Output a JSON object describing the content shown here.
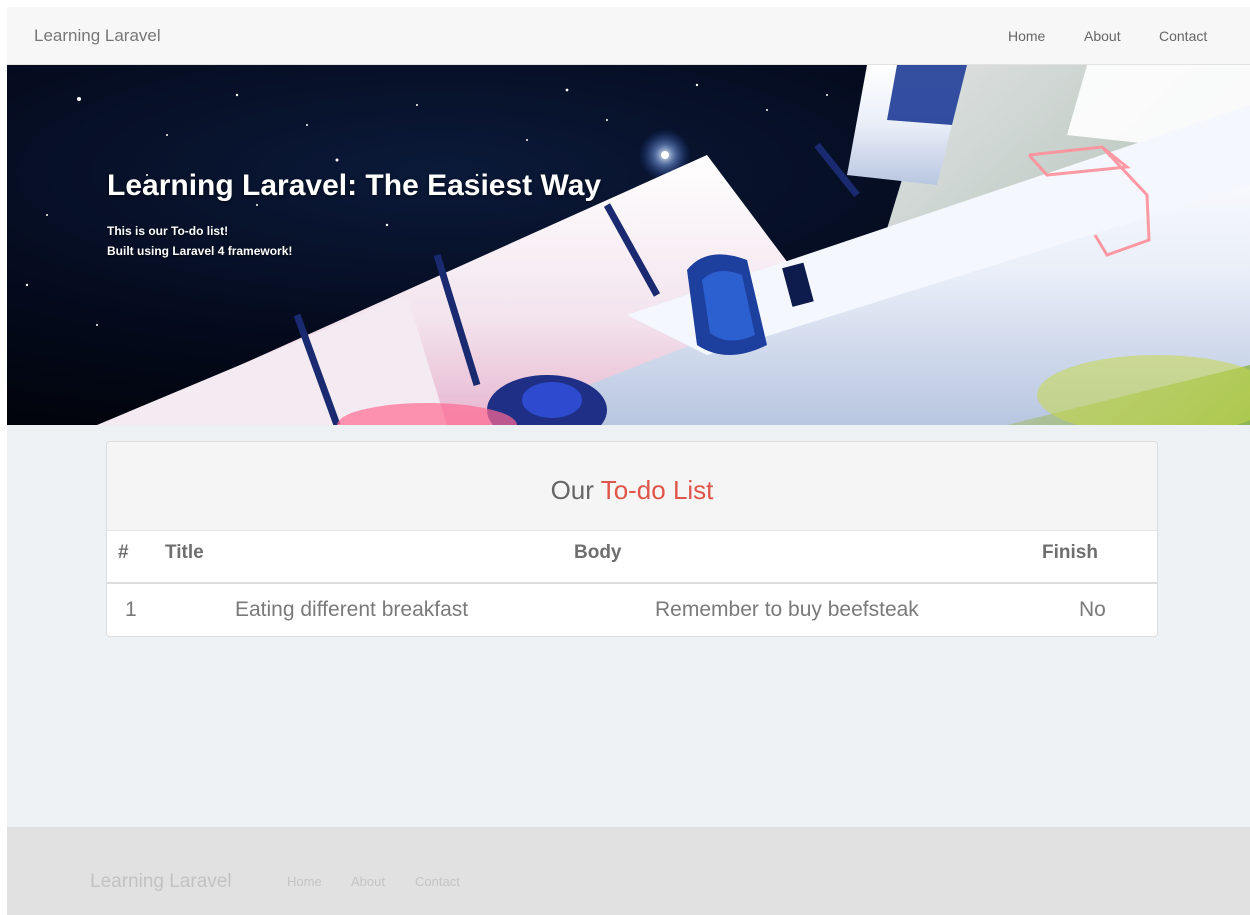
{
  "navbar": {
    "brand": "Learning Laravel",
    "links": [
      "Home",
      "About",
      "Contact"
    ]
  },
  "hero": {
    "title": "Learning Laravel: The Easiest Way",
    "lines": [
      "This is our To-do list!",
      "Built using Laravel 4 framework!"
    ]
  },
  "panel": {
    "title_prefix": "Our ",
    "title_accent": "To-do List",
    "columns": [
      "#",
      "Title",
      "Body",
      "Finish"
    ],
    "rows": [
      [
        "1",
        "Eating different breakfast",
        "Remember to buy beefsteak",
        "No"
      ]
    ]
  },
  "footer": {
    "brand": "Learning Laravel",
    "links": [
      "Home",
      "About",
      "Contact"
    ]
  },
  "colors": {
    "accent": "#e0554a",
    "navbar_bg": "#f7f7f7",
    "page_bg": "#eef1f3",
    "footer_bg": "#e1e1e1"
  },
  "icons": [
    "rocket-illustration",
    "laravel-logo-icon"
  ]
}
